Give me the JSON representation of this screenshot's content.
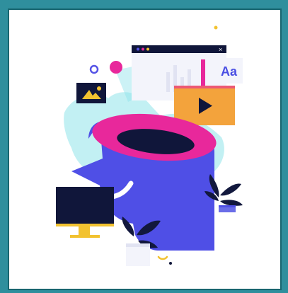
{
  "illustration": {
    "font_card_label": "Aa",
    "colors": {
      "background_teal": "#2f8f9d",
      "head_blue": "#4f4fe6",
      "magenta": "#e8289b",
      "yellow": "#f2c230",
      "orange": "#f3a33c",
      "navy": "#10163a",
      "cyan_splash": "#8fe3ea",
      "leaf_dark": "#12183d"
    },
    "icons": [
      "browser-window-icon",
      "image-card-icon",
      "play-video-icon",
      "font-card-icon",
      "monitor-icon",
      "plant-icon",
      "mug-icon"
    ]
  }
}
